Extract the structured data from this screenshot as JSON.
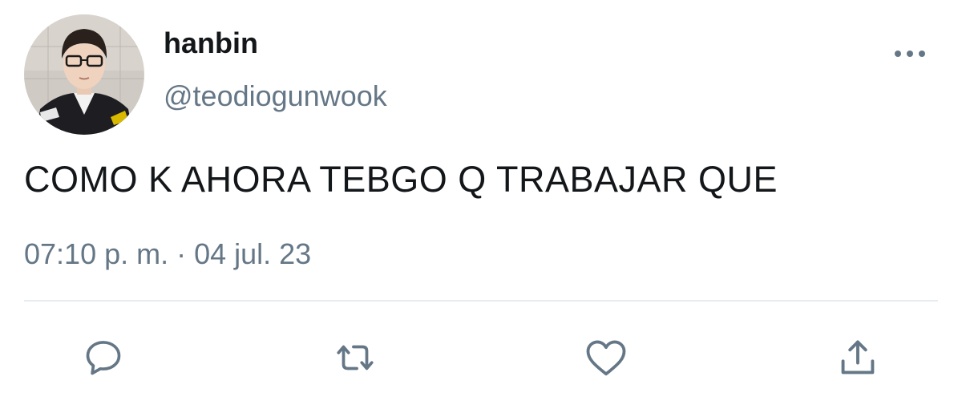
{
  "user": {
    "display_name": "hanbin",
    "handle": "@teodiogunwook"
  },
  "tweet": {
    "text": "COMO K AHORA TEBGO Q TRABAJAR QUE",
    "timestamp": "07:10 p. m. · 04 jul. 23"
  },
  "actions": [
    {
      "icon": "reply-icon"
    },
    {
      "icon": "retweet-icon"
    },
    {
      "icon": "like-icon"
    },
    {
      "icon": "share-icon"
    }
  ],
  "more_menu": {
    "icon": "more-options-icon"
  },
  "colors": {
    "text": "#14171a",
    "secondary": "#657786",
    "icon": "#657786",
    "divider": "#e6ecf0",
    "background": "#ffffff"
  }
}
